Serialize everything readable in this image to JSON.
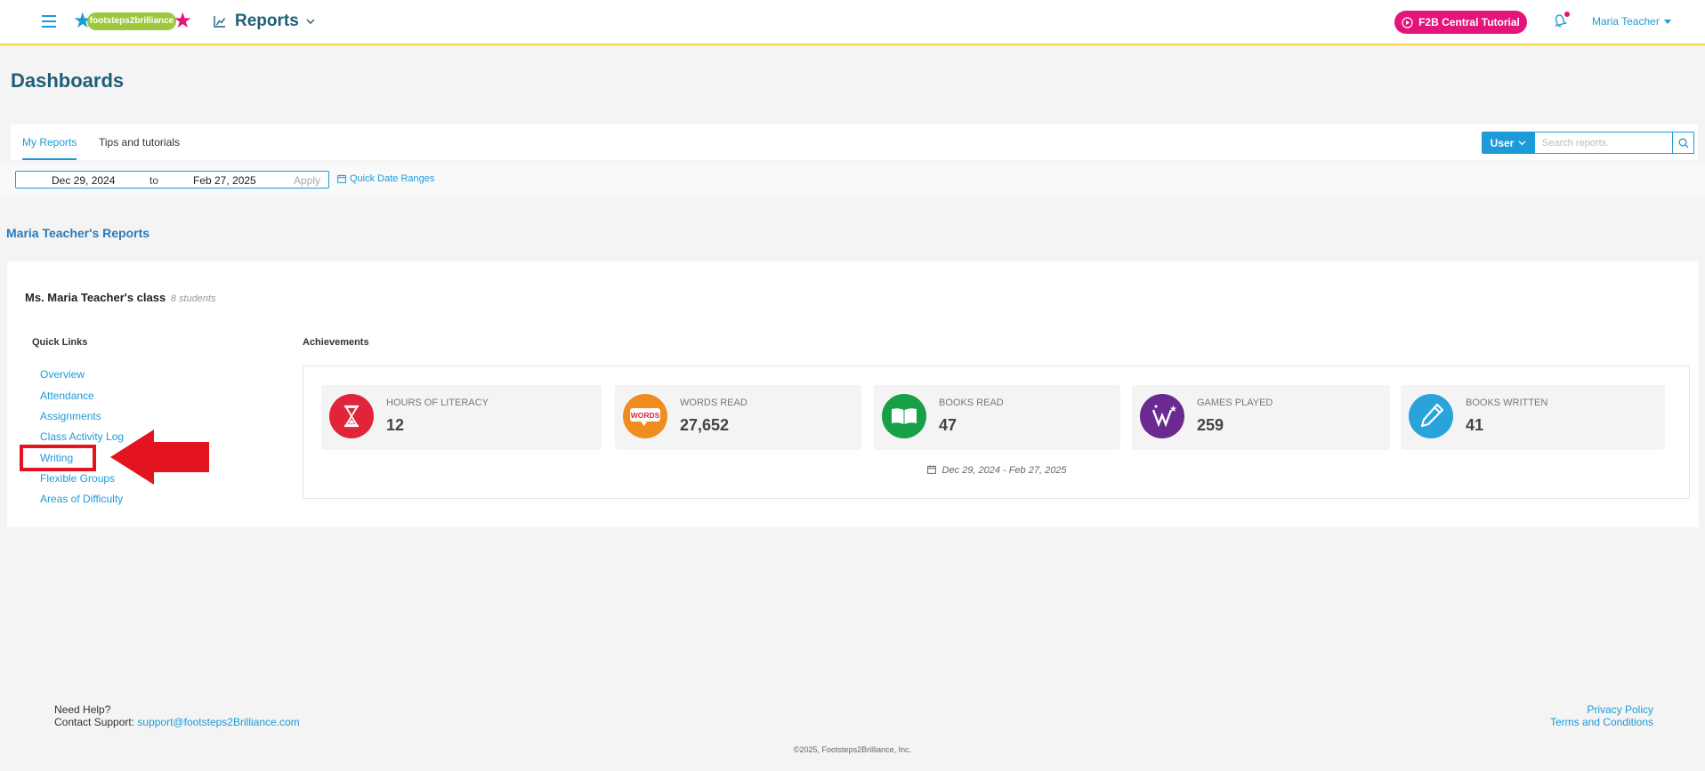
{
  "header": {
    "logo_text": "footsteps2brilliance",
    "section_title": "Reports",
    "tutorial_label": "F2B Central Tutorial",
    "user_name": "Maria Teacher"
  },
  "page": {
    "title": "Dashboards"
  },
  "tabs": [
    {
      "label": "My Reports",
      "active": true
    },
    {
      "label": "Tips and tutorials",
      "active": false
    }
  ],
  "search": {
    "scope_label": "User",
    "placeholder": "Search reports."
  },
  "date_filter": {
    "start": "Dec 29, 2024",
    "to_label": "to",
    "end": "Feb 27, 2025",
    "apply_label": "Apply",
    "quick_label": "Quick Date Ranges"
  },
  "reports_heading": "Maria Teacher's Reports",
  "class_card": {
    "title": "Ms. Maria Teacher's class",
    "students": "8 students",
    "quick_links_heading": "Quick Links",
    "quick_links": [
      "Overview",
      "Attendance",
      "Assignments",
      "Class Activity Log",
      "Writing",
      "Flexible Groups",
      "Areas of Difficulty"
    ],
    "achievements_heading": "Achievements",
    "achievements": [
      {
        "label": "Hours of Literacy",
        "value": "12",
        "icon": "hourglass-icon",
        "color": "#e2243b"
      },
      {
        "label": "Words Read",
        "value": "27,652",
        "icon": "words-icon",
        "color": "#ee8d1e"
      },
      {
        "label": "Books Read",
        "value": "47",
        "icon": "open-book-icon",
        "color": "#17a047"
      },
      {
        "label": "Games Played",
        "value": "259",
        "icon": "games-icon",
        "color": "#6a2a91"
      },
      {
        "label": "Books Written",
        "value": "41",
        "icon": "pencil-icon",
        "color": "#2aa3db"
      }
    ],
    "achievements_range": "Dec 29, 2024 - Feb 27, 2025",
    "words_badge_text": "WORDS"
  },
  "footer": {
    "help_label": "Need Help?",
    "contact_label": "Contact Support:",
    "contact_email": "support@footsteps2Brilliance.com",
    "privacy_label": "Privacy Policy",
    "terms_label": "Terms and Conditions",
    "copyright": "©2025, Footsteps2Brilliance, Inc."
  },
  "colors": {
    "accent": "#1d9bd9",
    "title": "#1f5f78",
    "tutorial": "#e5147b",
    "annotation": "#e3141f"
  }
}
